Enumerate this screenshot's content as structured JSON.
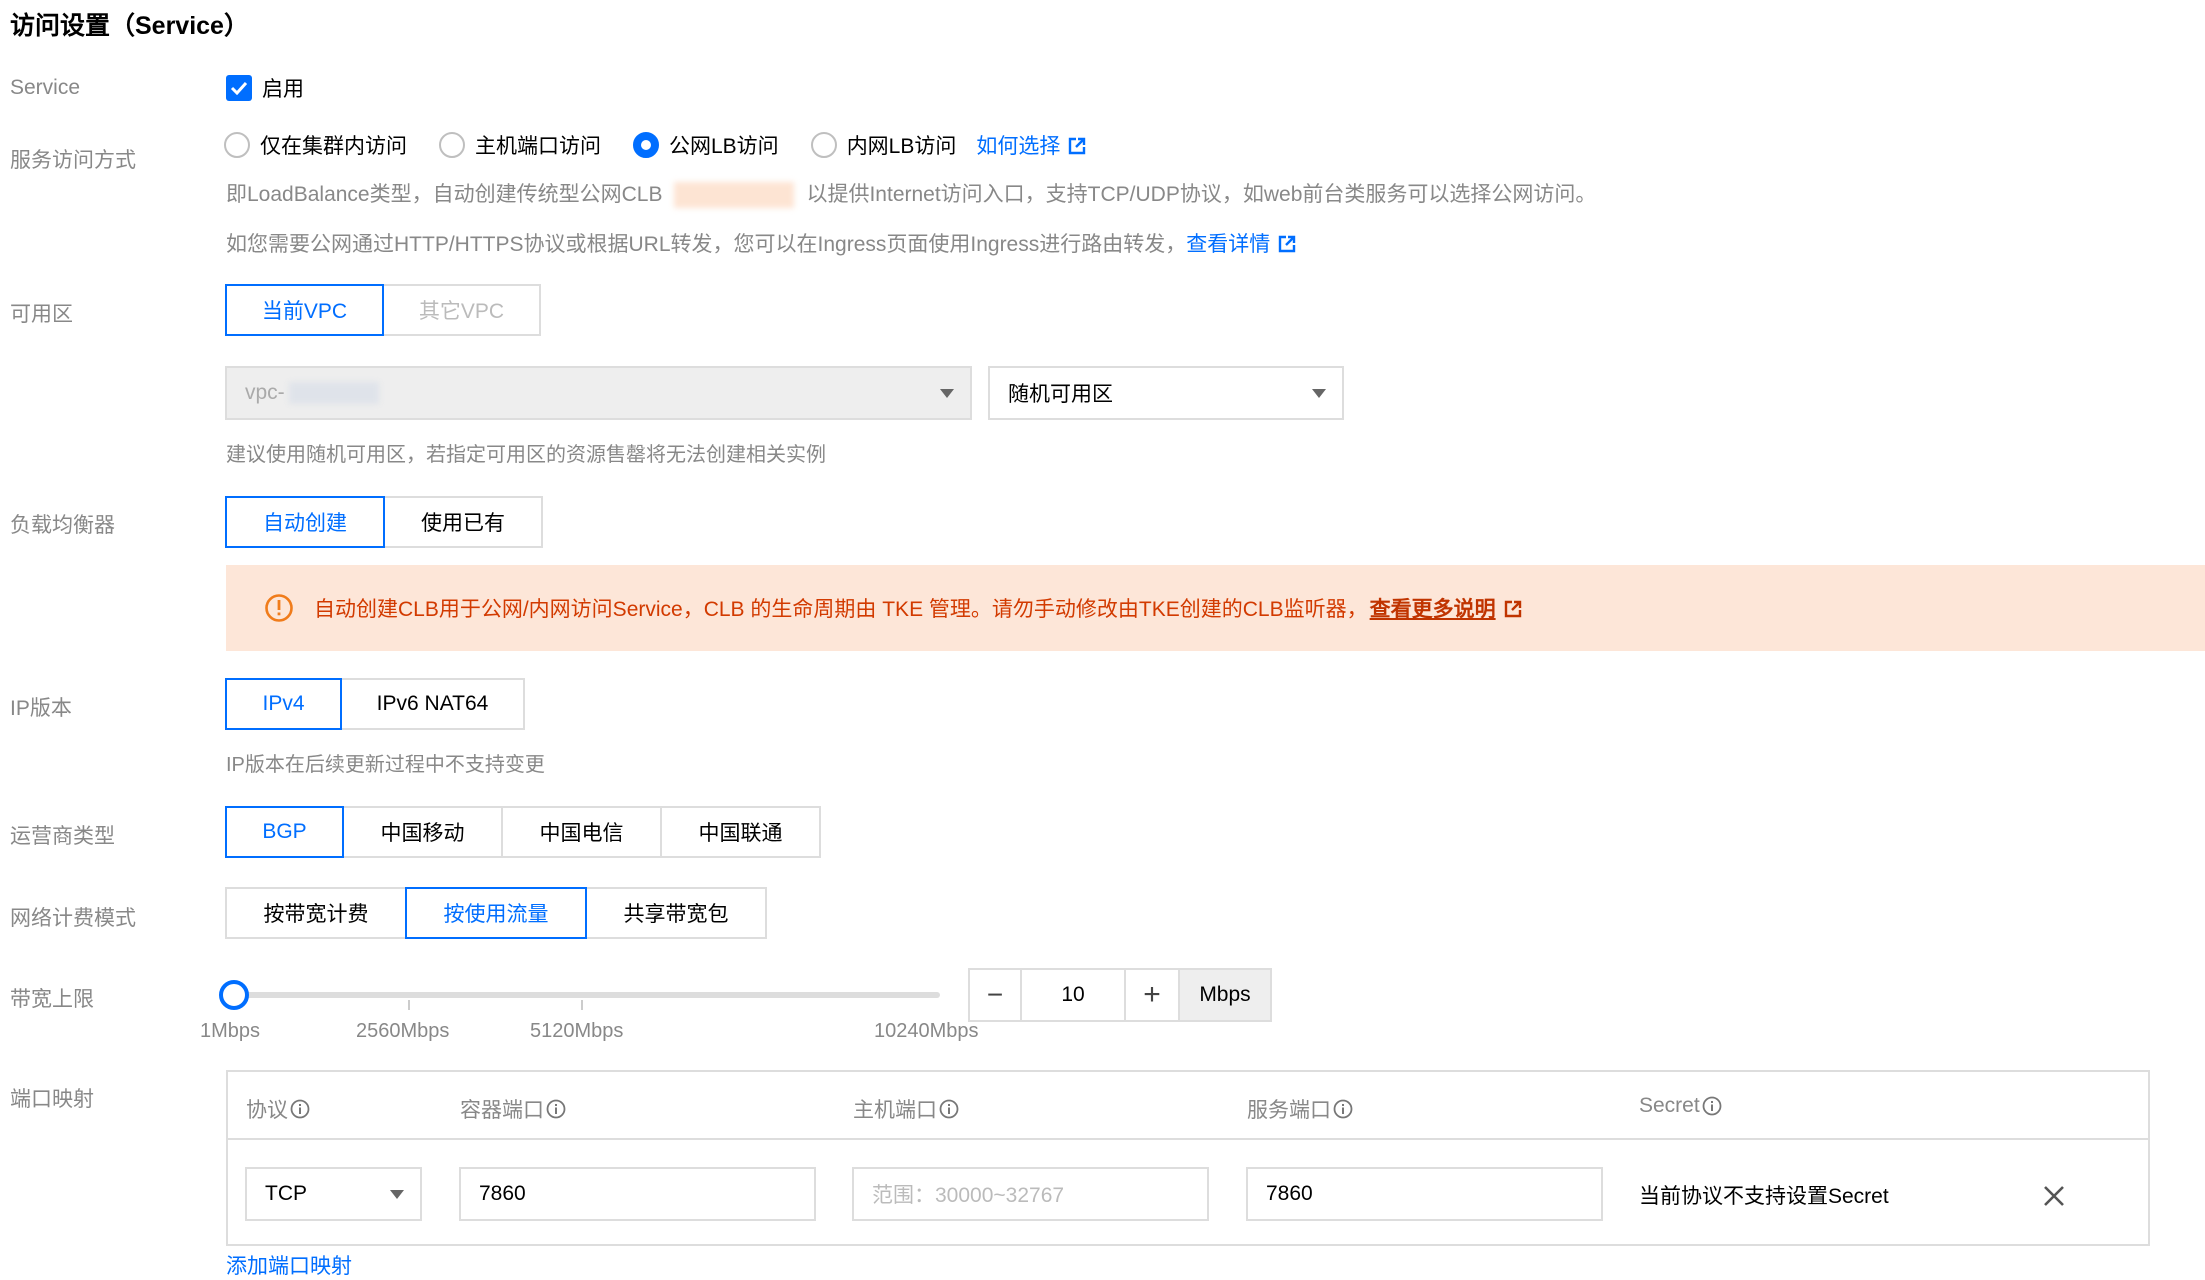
{
  "section_title": "访问设置（Service）",
  "service": {
    "label": "Service",
    "enable_label": "启用",
    "enabled": true
  },
  "access_mode": {
    "label": "服务访问方式",
    "options": [
      "仅在集群内访问",
      "主机端口访问",
      "公网LB访问",
      "内网LB访问"
    ],
    "selected": "公网LB访问",
    "help_link": "如何选择",
    "desc1_before": "即LoadBalance类型，自动创建传统型公网CLB",
    "desc1_after": "以提供Internet访问入口，支持TCP/UDP协议，如web前台类服务可以选择公网访问。",
    "desc2": "如您需要公网通过HTTP/HTTPS协议或根据URL转发，您可以在Ingress页面使用Ingress进行路由转发，",
    "desc2_link": "查看详情"
  },
  "zone": {
    "label": "可用区",
    "tabs": [
      "当前VPC",
      "其它VPC"
    ],
    "active": "当前VPC",
    "vpc_select": "vpc-",
    "zone_select": "随机可用区",
    "hint": "建议使用随机可用区，若指定可用区的资源售罄将无法创建相关实例"
  },
  "lb": {
    "label": "负载均衡器",
    "tabs": [
      "自动创建",
      "使用已有"
    ],
    "active": "自动创建",
    "alert_text": "自动创建CLB用于公网/内网访问Service，CLB 的生命周期由 TKE 管理。请勿手动修改由TKE创建的CLB监听器，",
    "alert_link": "查看更多说明"
  },
  "ip_version": {
    "label": "IP版本",
    "tabs": [
      "IPv4",
      "IPv6 NAT64"
    ],
    "active": "IPv4",
    "hint": "IP版本在后续更新过程中不支持变更"
  },
  "isp": {
    "label": "运营商类型",
    "tabs": [
      "BGP",
      "中国移动",
      "中国电信",
      "中国联通"
    ],
    "active": "BGP"
  },
  "billing": {
    "label": "网络计费模式",
    "tabs": [
      "按带宽计费",
      "按使用流量",
      "共享带宽包"
    ],
    "active": "按使用流量"
  },
  "bandwidth": {
    "label": "带宽上限",
    "ticks": [
      "1Mbps",
      "2560Mbps",
      "5120Mbps",
      "10240Mbps"
    ],
    "slider_min": 1,
    "slider_max": 10240,
    "value": "10",
    "unit": "Mbps",
    "minus": "−",
    "plus": "+"
  },
  "port_mapping": {
    "label": "端口映射",
    "columns": [
      "协议",
      "容器端口",
      "主机端口",
      "服务端口",
      "Secret"
    ],
    "row": {
      "protocol": "TCP",
      "container_port": "7860",
      "host_port_placeholder": "范围：30000~32767",
      "service_port": "7860",
      "secret_text": "当前协议不支持设置Secret"
    },
    "add_link": "添加端口映射"
  },
  "colors": {
    "accent": "#006eff",
    "alert_bg": "#fde6d8",
    "alert_text": "#d23a00",
    "muted": "#888888"
  }
}
